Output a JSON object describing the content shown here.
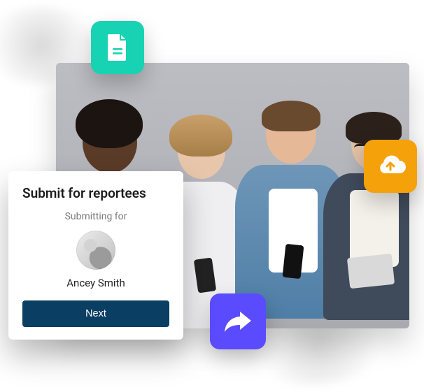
{
  "tiles": {
    "doc": {
      "name": "document-icon",
      "color": "#17d3b3"
    },
    "cloud": {
      "name": "cloud-upload-icon",
      "color": "#f5a10a"
    },
    "share": {
      "name": "share-icon",
      "color": "#5b4bff"
    }
  },
  "card": {
    "title": "Submit for reportees",
    "subtitle": "Submitting for",
    "person_name": "Ancey Smith",
    "next_label": "Next"
  }
}
